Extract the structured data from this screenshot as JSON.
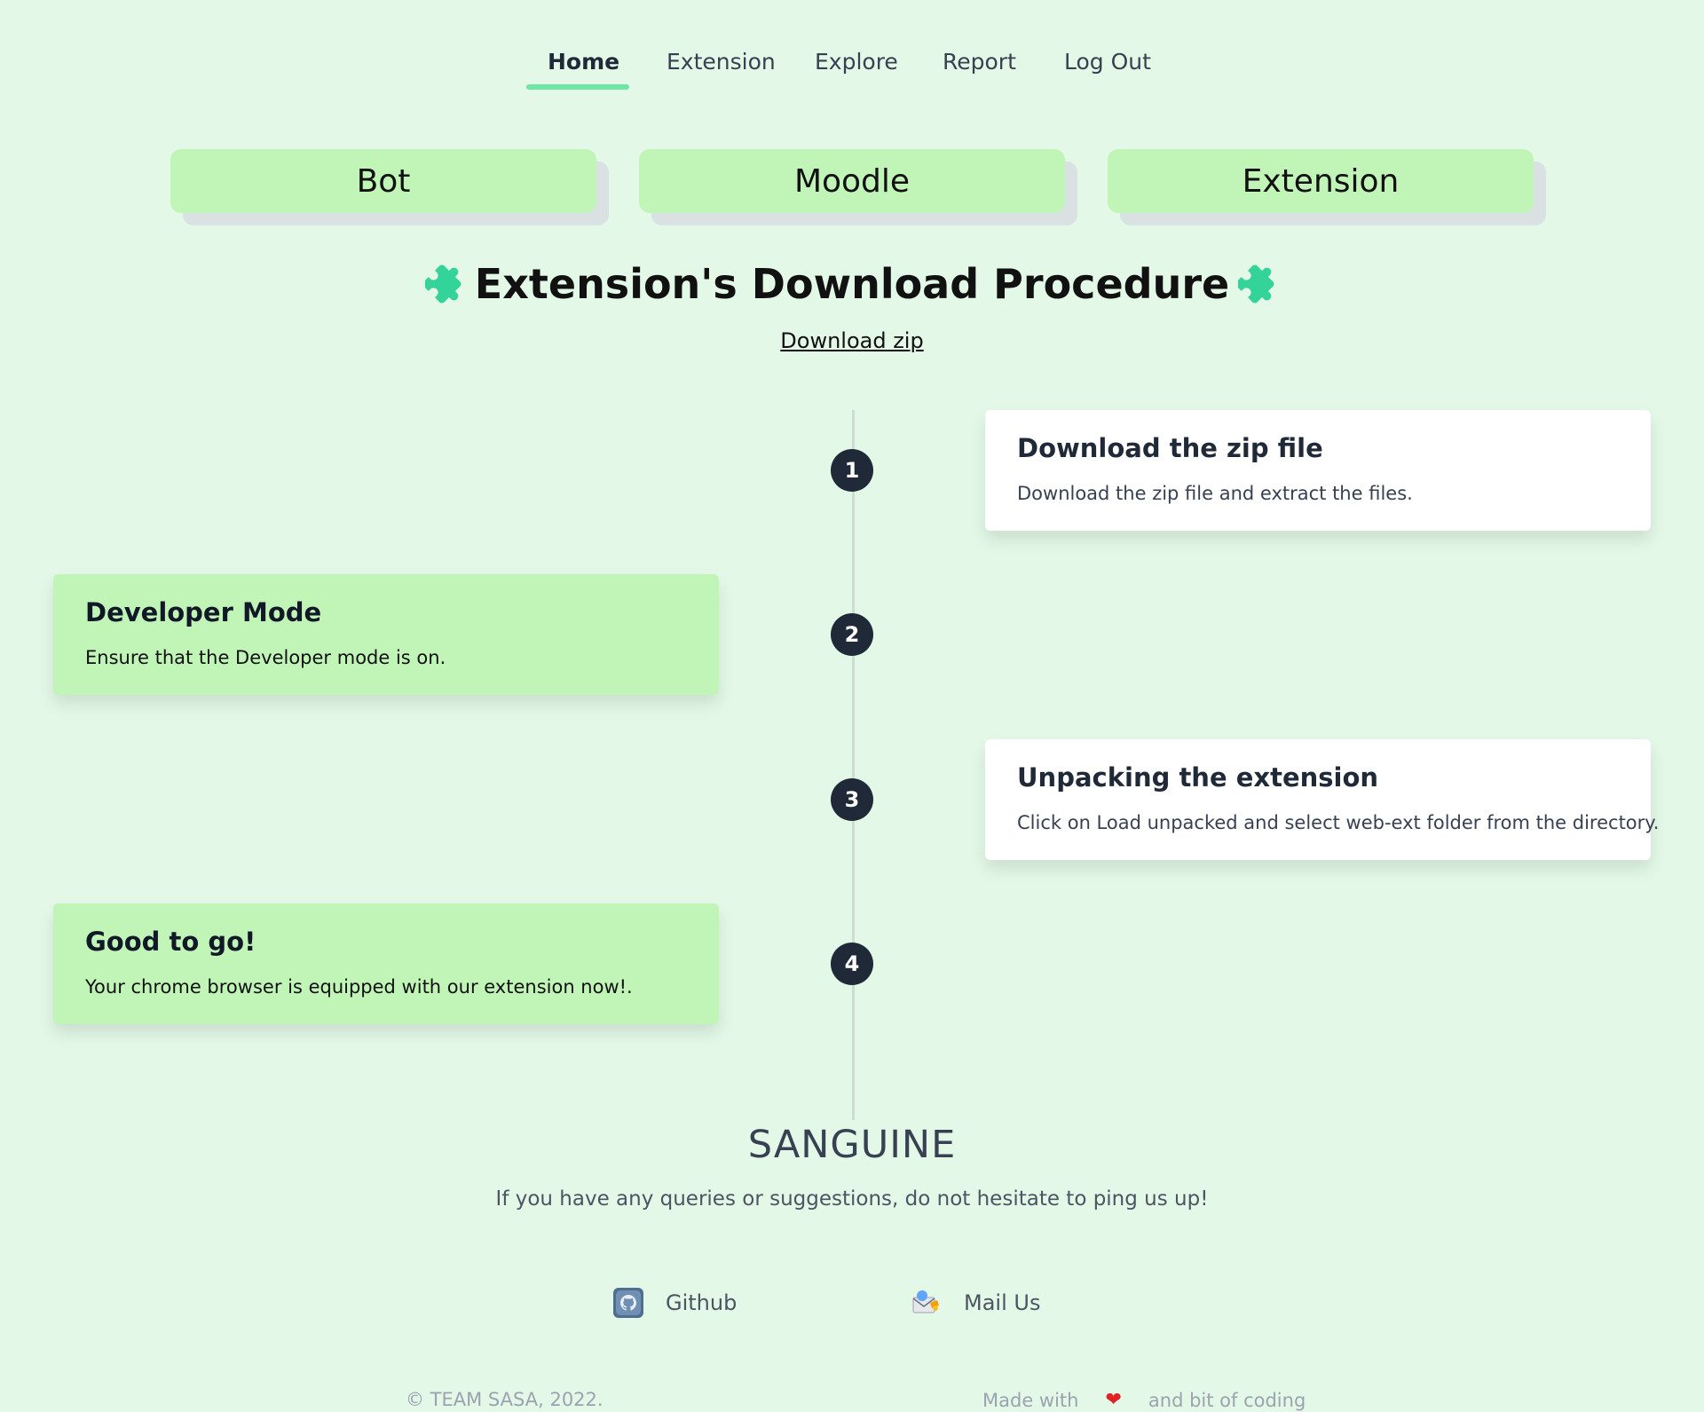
{
  "nav": {
    "items": [
      {
        "label": "Home",
        "active": true
      },
      {
        "label": "Extension"
      },
      {
        "label": "Explore"
      },
      {
        "label": "Report"
      },
      {
        "label": "Log Out"
      }
    ],
    "active_color": "#6ee7a4"
  },
  "top_buttons": [
    "Bot",
    "Moodle",
    "Extension"
  ],
  "heading": {
    "title": "Extension's Download Procedure",
    "icon": "puzzle-icon",
    "icon_color": "#34d399"
  },
  "download_link": "Download zip",
  "steps": [
    {
      "number": "1",
      "title": "Download the zip file",
      "desc": "Download the zip file and extract the files."
    },
    {
      "number": "2",
      "title": "Developer Mode",
      "desc": "Ensure that the Developer mode is on."
    },
    {
      "number": "3",
      "title": "Unpacking the extension",
      "desc": "Click on Load unpacked and select web-ext folder from the directory."
    },
    {
      "number": "4",
      "title": "Good to go!",
      "desc": "Your chrome browser is equipped with our extension now!."
    }
  ],
  "footer": {
    "brand": "SANGUINE",
    "tagline": "If you have any queries or suggestions, do not hesitate to ping us up!",
    "links": [
      {
        "label": "Github",
        "icon": "github-icon"
      },
      {
        "label": "Mail Us",
        "icon": "mail-icon"
      }
    ],
    "copyright": "© TEAM SASA, 2022.",
    "made_prefix": "Made with",
    "made_suffix": "and bit of coding",
    "heart_icon": "heart-icon"
  },
  "colors": {
    "background": "#e3f8e7",
    "card_green": "#c1f5b7",
    "step_circle": "#1f2937"
  }
}
